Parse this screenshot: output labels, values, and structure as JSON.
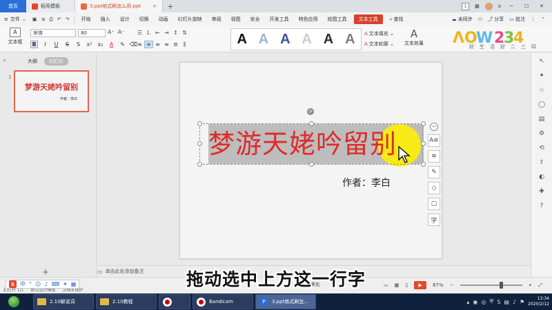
{
  "tabs": {
    "home": "首页",
    "template": "稻壳模板",
    "doc": "3.ppt格式刷怎么用.ppt",
    "page_count": "1",
    "user": "a"
  },
  "menu": {
    "file": "文件",
    "items": [
      "开始",
      "插入",
      "设计",
      "切换",
      "动画",
      "幻灯片放映",
      "审阅",
      "视图",
      "安全",
      "开发工具",
      "特色应用",
      "绘图工具",
      "文本工具"
    ],
    "search": "查找",
    "sync": "未同步",
    "share": "分享",
    "comment": "批注"
  },
  "ribbon": {
    "textbox": "文本框",
    "font": "宋体",
    "size": "80",
    "style_letter": "A",
    "text_fill": "文本填充",
    "text_outline": "文本轮廓",
    "text_effect": "文本效果",
    "style_colors": [
      "#111111",
      "#9bb7c9",
      "#3a4f9b",
      "#c7cdd3",
      "#2e2e2e",
      "#7d7d7d"
    ]
  },
  "logo": {
    "text": "ЛОЖ234",
    "sub": "好生活好二三四"
  },
  "left_panel": {
    "outline": "大纲",
    "slides": "幻灯片",
    "slide_number": "1",
    "thumb_title": "梦游天姥吟留别",
    "thumb_author": "作者：李白"
  },
  "slide": {
    "title": "梦游天姥吟留别",
    "author": "作者：李白"
  },
  "notes": {
    "placeholder": "单击此处添加备注"
  },
  "status": {
    "slide_info": "幻灯片 1/1",
    "theme": "默认设计模板",
    "protect": "文档未保护",
    "beautify": "一键美化",
    "zoom": "67%",
    "zoom_fraction": 0.67
  },
  "caption": "拖动选中上方这一行字",
  "taskbar": {
    "items": [
      {
        "label": "2.10解说词"
      },
      {
        "label": "2.10教程"
      },
      {
        "label": ""
      },
      {
        "label": "Bandicam"
      },
      {
        "label": "3.ppt格式刷怎..."
      }
    ],
    "date": "2020/2/12",
    "time": "13:34"
  },
  "accent": "#d8412b",
  "brand_blue": "#2b6fd6"
}
